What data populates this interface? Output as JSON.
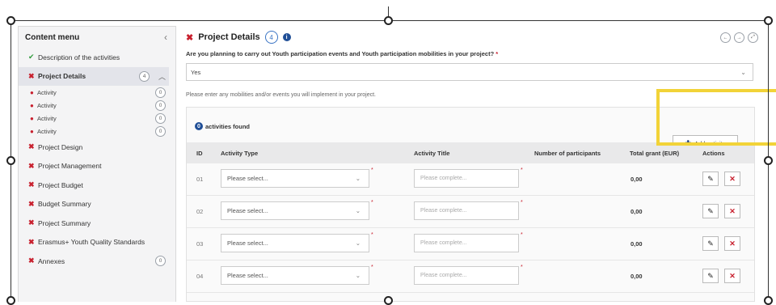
{
  "sidebar": {
    "title": "Content menu",
    "collapse_icon": "chevron-left-icon",
    "items": [
      {
        "label": "Description of the activities",
        "status": "check"
      },
      {
        "label": "Project Details",
        "status": "x",
        "badge": "4",
        "active": true
      },
      {
        "label": "Project Design",
        "status": "x"
      },
      {
        "label": "Project Management",
        "status": "x"
      },
      {
        "label": "Project Budget",
        "status": "x"
      },
      {
        "label": "Budget Summary",
        "status": "x"
      },
      {
        "label": "Project Summary",
        "status": "x"
      },
      {
        "label": "Erasmus+ Youth Quality Standards",
        "status": "x"
      },
      {
        "label": "Annexes",
        "status": "x",
        "badge": "0"
      }
    ],
    "subitems": [
      {
        "label": "Activity",
        "badge": "0"
      },
      {
        "label": "Activity",
        "badge": "0"
      },
      {
        "label": "Activity",
        "badge": "0"
      },
      {
        "label": "Activity",
        "badge": "0"
      }
    ]
  },
  "header": {
    "title": "Project Details",
    "count": "4",
    "info": "i"
  },
  "question": {
    "text": "Are you planning to carry out Youth participation events and Youth participation mobilities in your project?",
    "required_mark": "*",
    "value": "Yes"
  },
  "hint": "Please enter any mobilities and/or events you will implement in your project.",
  "activities": {
    "found_count": "0",
    "found_label": "activities found",
    "add_button": "Add activity",
    "columns": [
      "ID",
      "Activity Type",
      "Activity Title",
      "Number of participants",
      "Total grant (EUR)",
      "Actions"
    ],
    "rows": [
      {
        "id": "01",
        "type_placeholder": "Please select...",
        "title_placeholder": "Please complete...",
        "grant": "0,00"
      },
      {
        "id": "02",
        "type_placeholder": "Please select...",
        "title_placeholder": "Please complete...",
        "grant": "0,00"
      },
      {
        "id": "03",
        "type_placeholder": "Please select...",
        "title_placeholder": "Please complete...",
        "grant": "0,00"
      },
      {
        "id": "04",
        "type_placeholder": "Please select...",
        "title_placeholder": "Please complete...",
        "grant": "0,00"
      }
    ]
  },
  "colors": {
    "error": "#c8202e",
    "success": "#2e9a3a",
    "primary": "#1f4e96",
    "highlight": "#f2d338"
  }
}
